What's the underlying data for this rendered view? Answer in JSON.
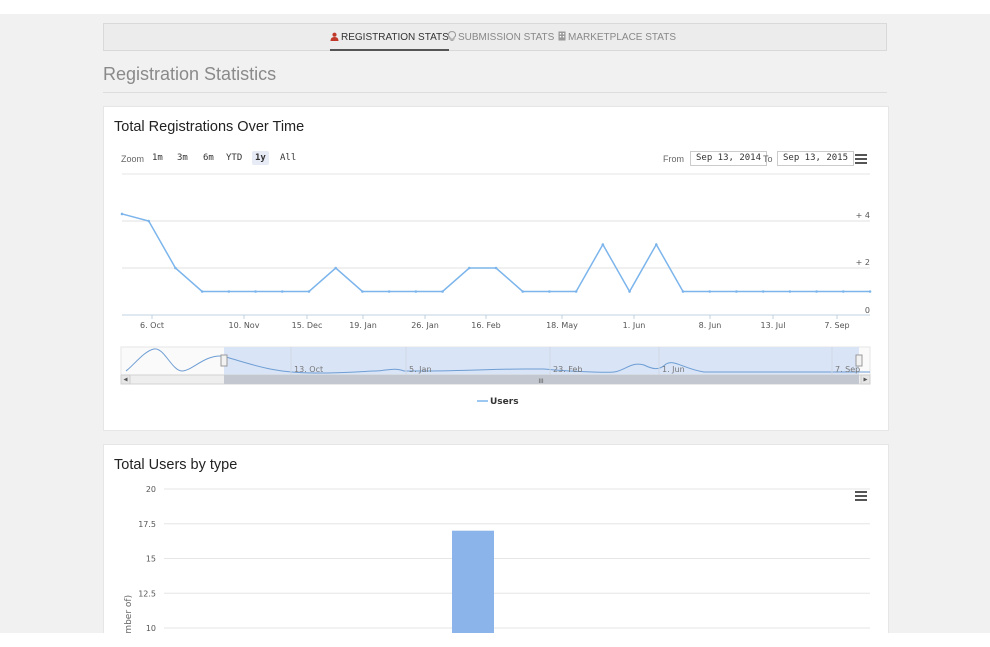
{
  "tabs": [
    {
      "label": "REGISTRATION STATS",
      "icon": "user-icon",
      "active": true
    },
    {
      "label": "SUBMISSION STATS",
      "icon": "lightbulb-icon",
      "active": false
    },
    {
      "label": "MARKETPLACE STATS",
      "icon": "building-icon",
      "active": false
    }
  ],
  "page_title": "Registration Statistics",
  "chart1": {
    "title": "Total Registrations Over Time",
    "zoom_label": "Zoom",
    "zoom_buttons": [
      "1m",
      "3m",
      "6m",
      "YTD",
      "1y",
      "All"
    ],
    "zoom_selected": "1y",
    "from_label": "From",
    "from_value": "Sep 13, 2014",
    "to_label": "To",
    "to_value": "Sep 13, 2015",
    "menu_icon": "hamburger-menu-icon"
  },
  "chart2": {
    "title": "Total Users by type",
    "menu_icon": "hamburger-menu-icon"
  },
  "colors": {
    "series": "#7cb5ec",
    "bar": "#8ab4ea",
    "accent_user_icon": "#c0392b"
  },
  "chart_data": [
    {
      "type": "line",
      "title": "Total Registrations Over Time",
      "x_tick_labels": [
        "6. Oct",
        "10. Nov",
        "15. Dec",
        "19. Jan",
        "26. Jan",
        "16. Feb",
        "18. May",
        "1. Jun",
        "8. Jun",
        "13. Jul",
        "7. Sep"
      ],
      "y_tick_labels": [
        "0",
        "2",
        "4"
      ],
      "ylim": [
        0,
        4.5
      ],
      "series": [
        {
          "name": "Users",
          "values": [
            4.3,
            4,
            2,
            1,
            1,
            1,
            1,
            1,
            2,
            1,
            1,
            1,
            1,
            2,
            2,
            1,
            1,
            1,
            3,
            1,
            3,
            1,
            1,
            1,
            1,
            1,
            1,
            1,
            1
          ]
        }
      ],
      "navigator_labels": [
        "13. Oct",
        "5. Jan",
        "23. Feb",
        "1. Jun",
        "7. Sep"
      ],
      "navigator_scroll_label": "III",
      "legend": "Users",
      "legend_position": "bottom-center"
    },
    {
      "type": "bar",
      "title": "Total Users by type",
      "ylabel": "number of)",
      "y_tick_labels": [
        "20",
        "17.5",
        "15",
        "12.5",
        "10"
      ],
      "ylim_visible": [
        10,
        20
      ],
      "series": [
        {
          "values": [
            17
          ]
        }
      ]
    }
  ]
}
